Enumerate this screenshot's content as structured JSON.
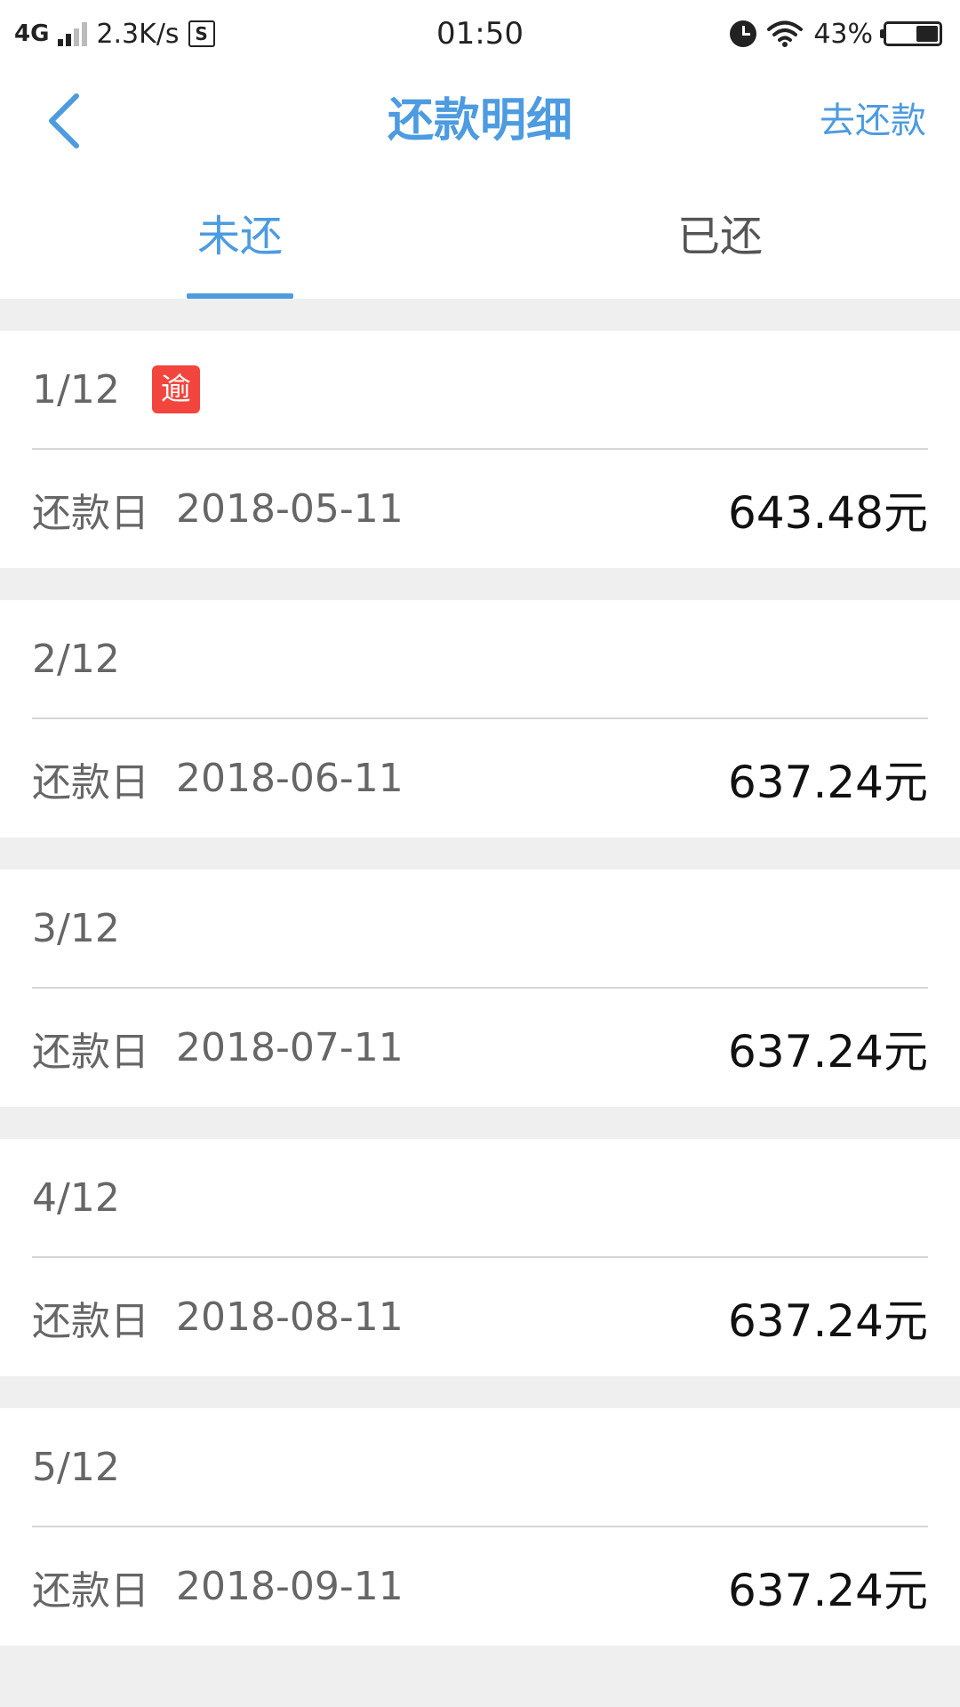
{
  "status_bar": {
    "network": "4G",
    "speed": "2.3K/s",
    "s_icon_label": "S",
    "time": "01:50",
    "battery": "43%"
  },
  "nav": {
    "title": "还款明细",
    "action": "去还款",
    "icon": "chevron-left-icon"
  },
  "tabs": [
    {
      "label": "未还",
      "active": true
    },
    {
      "label": "已还",
      "active": false
    }
  ],
  "installments": [
    {
      "period": "1/12",
      "badge": "逾",
      "due_label": "还款日",
      "due_date": "2018-05-11",
      "amount": "643.48元"
    },
    {
      "period": "2/12",
      "badge": "",
      "due_label": "还款日",
      "due_date": "2018-06-11",
      "amount": "637.24元"
    },
    {
      "period": "3/12",
      "badge": "",
      "due_label": "还款日",
      "due_date": "2018-07-11",
      "amount": "637.24元"
    },
    {
      "period": "4/12",
      "badge": "",
      "due_label": "还款日",
      "due_date": "2018-08-11",
      "amount": "637.24元"
    },
    {
      "period": "5/12",
      "badge": "",
      "due_label": "还款日",
      "due_date": "2018-09-11",
      "amount": "637.24元"
    }
  ],
  "colors": {
    "accent": "#4d9be0",
    "overdue": "#f2453d",
    "separator": "#efefef"
  }
}
